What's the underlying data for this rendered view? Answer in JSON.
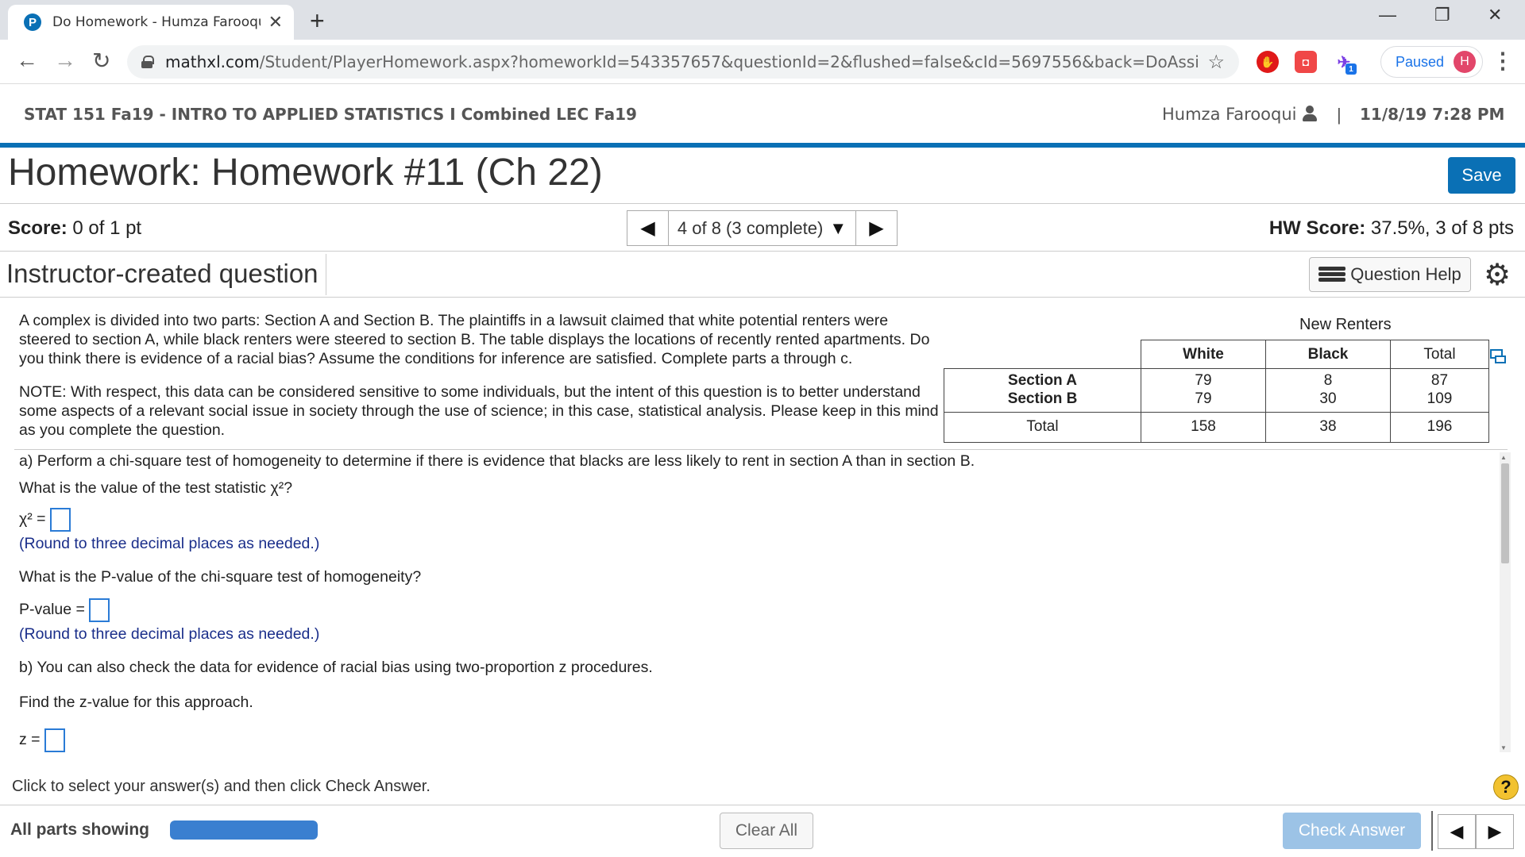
{
  "browser": {
    "tab_title": "Do Homework - Humza Farooqui",
    "favicon_letter": "P",
    "url_host": "mathxl.com",
    "url_path": "/Student/PlayerHomework.aspx?homeworkId=543357657&questionId=2&flushed=false&cId=5697556&back=DoAssignment...",
    "paused_label": "Paused",
    "avatar_letter": "H",
    "extension_badge": "1"
  },
  "header": {
    "course_title": "STAT 151 Fa19 - INTRO TO APPLIED STATISTICS I Combined LEC Fa19",
    "user_name": "Humza Farooqui",
    "separator": "|",
    "datetime": "11/8/19 7:28 PM"
  },
  "homework": {
    "title": "Homework: Homework #11 (Ch 22)",
    "save_label": "Save",
    "score_label": "Score:",
    "score_value": " 0 of 1 pt",
    "question_nav": "4 of 8 (3 complete)",
    "hw_score_label": "HW Score:",
    "hw_score_value": " 37.5%, 3 of 8 pts",
    "question_type": "Instructor-created question",
    "question_help_label": "Question Help"
  },
  "problem": {
    "intro": [
      "A complex is divided into two parts: Section A and Section B. The plaintiffs in a lawsuit claimed that white potential renters were",
      "steered to section A, while black renters were steered to section B. The table displays the locations of recently rented apartments. Do",
      "you think there is evidence of a racial bias? Assume the conditions for inference are satisfied. Complete parts a through c."
    ],
    "note": [
      "NOTE: With respect, this data can be considered sensitive to some individuals, but the intent of this question is to better understand",
      "some aspects of a relevant social issue in society through the use of science; in this case, statistical analysis. Please keep in this mind",
      "as you complete the question."
    ],
    "table": {
      "title": "New Renters",
      "headers": [
        "White",
        "Black",
        "Total"
      ],
      "rows": [
        {
          "label": "Section A",
          "values": [
            "79",
            "8",
            "87"
          ]
        },
        {
          "label": "Section B",
          "values": [
            "79",
            "30",
            "109"
          ]
        }
      ],
      "total_row": {
        "label": "Total",
        "values": [
          "158",
          "38",
          "196"
        ]
      }
    },
    "part_a": "a) Perform a chi-square test of homogeneity to determine if there is evidence that blacks are less likely to rent in section A than in section B.",
    "q_chi": "What is the value of the test statistic χ²?",
    "chi_label": "χ² =",
    "hint1": "(Round to three decimal places as needed.)",
    "q_p": "What is the P-value of the chi-square test of homogeneity?",
    "p_label": "P-value =",
    "hint2": "(Round to three decimal places as needed.)",
    "part_b": "b) You can also check the data for evidence of racial bias using two-proportion z procedures.",
    "q_z": "Find the z-value for this approach.",
    "z_label": "z ="
  },
  "footer": {
    "hint": "Click to select your answer(s) and then click Check Answer.",
    "help_mark": "?",
    "all_parts": "All parts showing",
    "progress_fraction": 1.0,
    "clear_all": "Clear All",
    "check_answer": "Check Answer"
  }
}
